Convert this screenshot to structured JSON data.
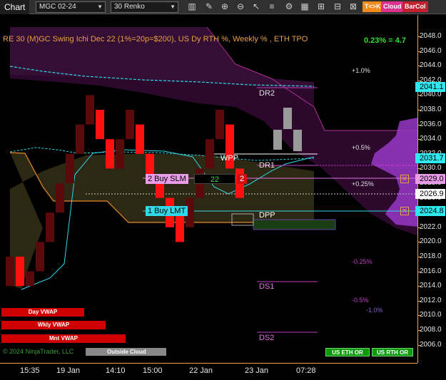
{
  "toolbar": {
    "title": "Chart",
    "instrument": "MGC 02-24",
    "bar_type": "30 Renko",
    "tk_label": "T<>K",
    "cloud_label": "Cloud",
    "barcol_label": "BarCol"
  },
  "chart": {
    "title": "RE 30 (M)GC Swing Ichi Dec 22 (1%=20p=$200), US Dy RTH %, Weekly % , ETH TPO",
    "pct_readout": "0.23% = 4.7",
    "price_ticks": [
      "2048.0",
      "2046.0",
      "2044.0",
      "2042.0",
      "2040.0",
      "2038.0",
      "2036.0",
      "2034.0",
      "2032.0",
      "2030.0",
      "2028.0",
      "2026.0",
      "2024.0",
      "2022.0",
      "2020.0",
      "2018.0",
      "2016.0",
      "2014.0",
      "2012.0",
      "2010.0",
      "2008.0",
      "2006.0"
    ],
    "time_labels": [
      "15:35",
      "19 Jan",
      "14:10",
      "15:00",
      "22 Jan",
      "23 Jan",
      "07:28"
    ],
    "percent_levels": [
      "+1.0%",
      "+0.5%",
      "+0.25%",
      "-0.25%",
      "-0.5%",
      "-1.0%"
    ],
    "levels": {
      "dr2": "DR2",
      "dr1": "DR1",
      "wpp": "WPP",
      "dpp": "DPP",
      "ds1": "DS1",
      "ds2": "DS2"
    },
    "orders": {
      "buy_slm": "2 Buy SLM",
      "buy_lmt": "1 Buy LMT",
      "order_qty": "22",
      "order_count": "2"
    },
    "price_tags": {
      "t2041": "2041.1",
      "t2031": "2031.7",
      "t2029": "2029.0",
      "t2026": "2026.9",
      "t2024": "2024.8"
    },
    "vwap": {
      "day": "Day VWAP",
      "weekly": "Wkly VWAP",
      "monthly": "Mnt VWAP"
    },
    "watermark": "© 2024 NinjaTrader, LLC",
    "outside_cloud": "Outside Cloud",
    "buttons": {
      "us_eth": "US ETH OR",
      "us_rth": "US RTH OR"
    },
    "colors": {
      "bull": "#1a0000",
      "bear": "#ff0000",
      "axis": "#e8a040",
      "cloud_purple": "#3a0f3a",
      "cloud_olive": "#2f2a14"
    }
  },
  "chart_data": {
    "type": "renko",
    "bricks": [
      {
        "o": 2014.0,
        "c": 2018.0
      },
      {
        "o": 2018.0,
        "c": 2014.0
      },
      {
        "o": 2014.0,
        "c": 2016.0
      },
      {
        "o": 2016.0,
        "c": 2020.0
      },
      {
        "o": 2020.0,
        "c": 2024.0
      },
      {
        "o": 2024.0,
        "c": 2028.0
      },
      {
        "o": 2028.0,
        "c": 2032.0
      },
      {
        "o": 2032.0,
        "c": 2036.0
      },
      {
        "o": 2036.0,
        "c": 2040.0
      },
      {
        "o": 2038.0,
        "c": 2034.0
      },
      {
        "o": 2034.0,
        "c": 2030.0
      },
      {
        "o": 2030.0,
        "c": 2034.0
      },
      {
        "o": 2034.0,
        "c": 2038.0
      },
      {
        "o": 2036.0,
        "c": 2032.0
      },
      {
        "o": 2032.0,
        "c": 2028.0
      },
      {
        "o": 2028.0,
        "c": 2026.0
      },
      {
        "o": 2026.0,
        "c": 2022.0
      },
      {
        "o": 2024.0,
        "c": 2020.0
      },
      {
        "o": 2022.0,
        "c": 2026.0
      },
      {
        "o": 2026.0,
        "c": 2030.0
      },
      {
        "o": 2030.0,
        "c": 2034.0
      },
      {
        "o": 2034.0,
        "c": 2038.0
      },
      {
        "o": 2036.0,
        "c": 2030.0
      },
      {
        "o": 2030.0,
        "c": 2026.0
      }
    ]
  }
}
